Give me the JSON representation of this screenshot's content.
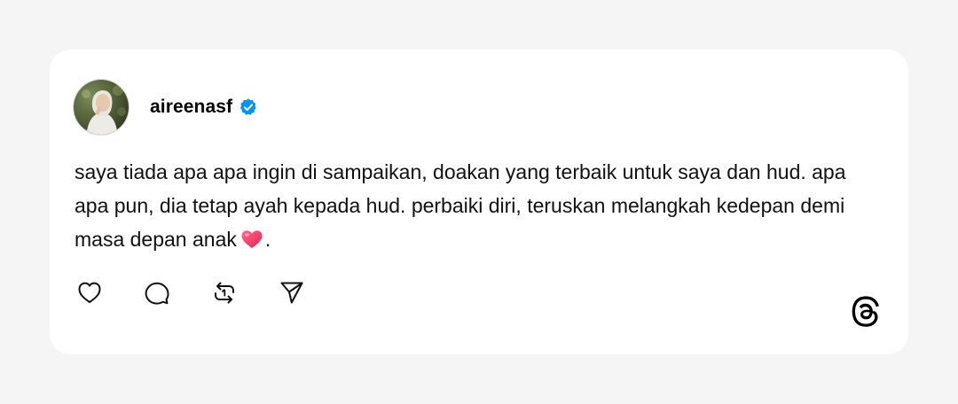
{
  "post": {
    "username": "aireenasf",
    "verified": true,
    "text_lines": [
      "saya tiada apa apa ingin di sampaikan, doakan yang terbaik untuk saya dan",
      "hud. apa apa pun, dia tetap ayah kepada hud. perbaiki diri, teruskan",
      "melangkah kedepan demi masa depan anak"
    ],
    "text_end": ".",
    "emoji": "heart-emoji"
  },
  "actions": [
    {
      "name": "like-button",
      "icon": "heart-outline-icon"
    },
    {
      "name": "reply-button",
      "icon": "comment-bubble-icon"
    },
    {
      "name": "repost-button",
      "icon": "repost-icon"
    },
    {
      "name": "share-button",
      "icon": "send-paper-plane-icon"
    }
  ],
  "brand": {
    "logo": "threads-logo-icon"
  },
  "colors": {
    "background": "#f5f5f5",
    "card": "#ffffff",
    "text": "#111111",
    "verified_badge": "#0095f6",
    "heart_emoji": "#f0365f"
  }
}
